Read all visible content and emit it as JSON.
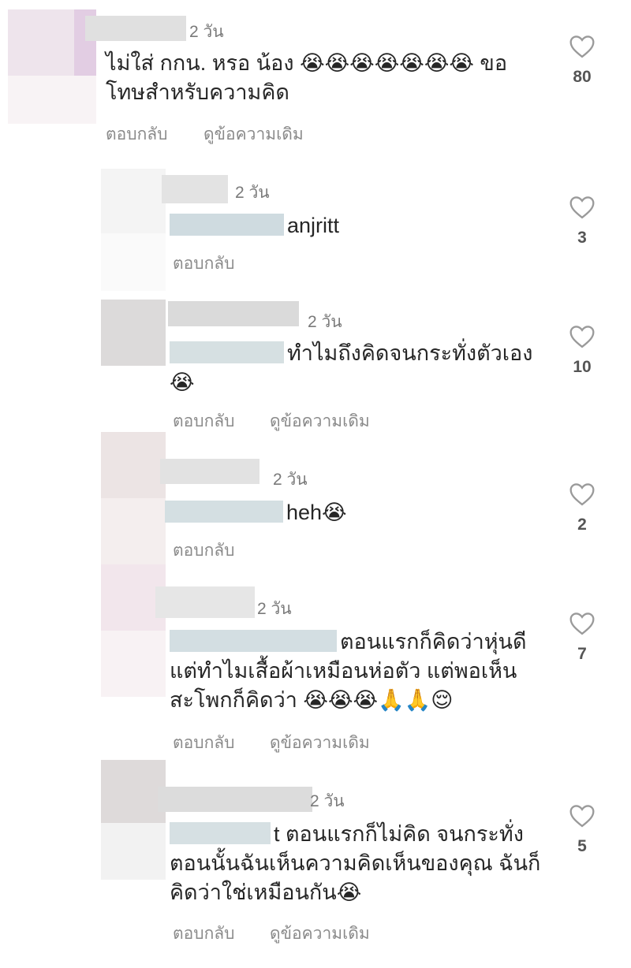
{
  "comments": [
    {
      "time": "2 วัน",
      "text_parts": [
        "ไม่ใส่ กกน. หรอ น้อง 😭😭😭😭😭😭😭 ขอ",
        "โทษสำหรับความคิด"
      ],
      "actions": {
        "reply": "ตอบกลับ",
        "view_original": "ดูข้อความเดิม"
      },
      "likes": "80"
    },
    {
      "time": "2 วัน",
      "text_parts": [
        "anjritt"
      ],
      "actions": {
        "reply": "ตอบกลับ"
      },
      "likes": "3"
    },
    {
      "time": "2 วัน",
      "text_parts": [
        "ทำไมถึงคิดจนกระทั่งตัวเอง",
        "😭"
      ],
      "actions": {
        "reply": "ตอบกลับ",
        "view_original": "ดูข้อความเดิม"
      },
      "likes": "10"
    },
    {
      "time": "2 วัน",
      "text_parts": [
        "heh😭"
      ],
      "actions": {
        "reply": "ตอบกลับ"
      },
      "likes": "2"
    },
    {
      "time": "2 วัน",
      "text_parts": [
        "ตอนแรกก็คิดว่าหุ่นดี",
        "แต่ทำไมเสื้อผ้าเหมือนห่อตัว แต่พอเห็น",
        "สะโพกก็คิดว่า 😭😭😭🙏🙏😌"
      ],
      "actions": {
        "reply": "ตอบกลับ",
        "view_original": "ดูข้อความเดิม"
      },
      "likes": "7"
    },
    {
      "time": "2 วัน",
      "text_parts": [
        "t ตอนแรกก็ไม่คิด จนกระทั่ง",
        "ตอนนั้นฉันเห็นความคิดเห็นของคุณ ฉันก็",
        "คิดว่าใช่เหมือนกัน😭"
      ],
      "actions": {
        "reply": "ตอบกลับ",
        "view_original": "ดูข้อความเดิม"
      },
      "likes": "5"
    }
  ],
  "icons": {
    "like": "heart-outline-icon"
  },
  "colors": {
    "text": "#262626",
    "meta": "#7a7a7a",
    "action": "#8a8a8a",
    "mention_blur": "#cfdbe0",
    "name_blur": "#dcdcdc"
  }
}
